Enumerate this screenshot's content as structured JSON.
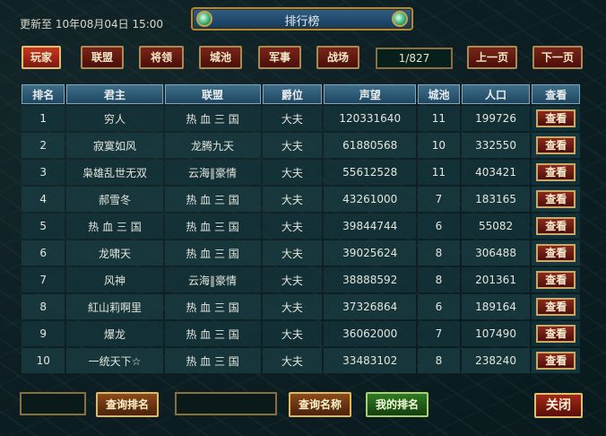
{
  "title": "排行榜",
  "update_text": "更新至 10年08月04日 15:00",
  "tabs": [
    {
      "label": "玩家",
      "active": true
    },
    {
      "label": "联盟",
      "active": false
    },
    {
      "label": "将领",
      "active": false
    },
    {
      "label": "城池",
      "active": false
    },
    {
      "label": "军事",
      "active": false
    },
    {
      "label": "战场",
      "active": false
    }
  ],
  "pagination": {
    "indicator": "1/827",
    "prev": "上一页",
    "next": "下一页"
  },
  "columns": [
    "排名",
    "君主",
    "联盟",
    "爵位",
    "声望",
    "城池",
    "人口",
    "查看"
  ],
  "rows": [
    {
      "rank": "1",
      "lord": "穷人",
      "alliance": "热 血 三 国",
      "title": "大夫",
      "prestige": "120331640",
      "cities": "11",
      "population": "199726",
      "view": "查看"
    },
    {
      "rank": "2",
      "lord": "寂寞如风",
      "alliance": "龙腾九天",
      "title": "大夫",
      "prestige": "61880568",
      "cities": "10",
      "population": "332550",
      "view": "查看"
    },
    {
      "rank": "3",
      "lord": "枭雄乱世无双",
      "alliance": "云海‖豪情",
      "title": "大夫",
      "prestige": "55612528",
      "cities": "11",
      "population": "403421",
      "view": "查看"
    },
    {
      "rank": "4",
      "lord": "郝雪冬",
      "alliance": "热 血 三 国",
      "title": "大夫",
      "prestige": "43261000",
      "cities": "7",
      "population": "183165",
      "view": "查看"
    },
    {
      "rank": "5",
      "lord": "热 血 三 国",
      "alliance": "热 血 三 国",
      "title": "大夫",
      "prestige": "39844744",
      "cities": "6",
      "population": "55082",
      "view": "查看"
    },
    {
      "rank": "6",
      "lord": "龙啸天",
      "alliance": "热 血 三 国",
      "title": "大夫",
      "prestige": "39025624",
      "cities": "8",
      "population": "306488",
      "view": "查看"
    },
    {
      "rank": "7",
      "lord": "风神",
      "alliance": "云海‖豪情",
      "title": "大夫",
      "prestige": "38888592",
      "cities": "8",
      "population": "201361",
      "view": "查看"
    },
    {
      "rank": "8",
      "lord": "紅山莉啊里",
      "alliance": "热 血 三 国",
      "title": "大夫",
      "prestige": "37326864",
      "cities": "6",
      "population": "189164",
      "view": "查看"
    },
    {
      "rank": "9",
      "lord": "爆龙",
      "alliance": "热 血 三 国",
      "title": "大夫",
      "prestige": "36062000",
      "cities": "7",
      "population": "107490",
      "view": "查看"
    },
    {
      "rank": "10",
      "lord": "一统天下☆",
      "alliance": "热 血 三 国",
      "title": "大夫",
      "prestige": "33483102",
      "cities": "8",
      "population": "238240",
      "view": "查看"
    }
  ],
  "footer": {
    "query_rank": "查询排名",
    "query_name": "查询名称",
    "my_rank": "我的排名",
    "close": "关闭",
    "rank_input_value": "",
    "name_input_value": ""
  }
}
